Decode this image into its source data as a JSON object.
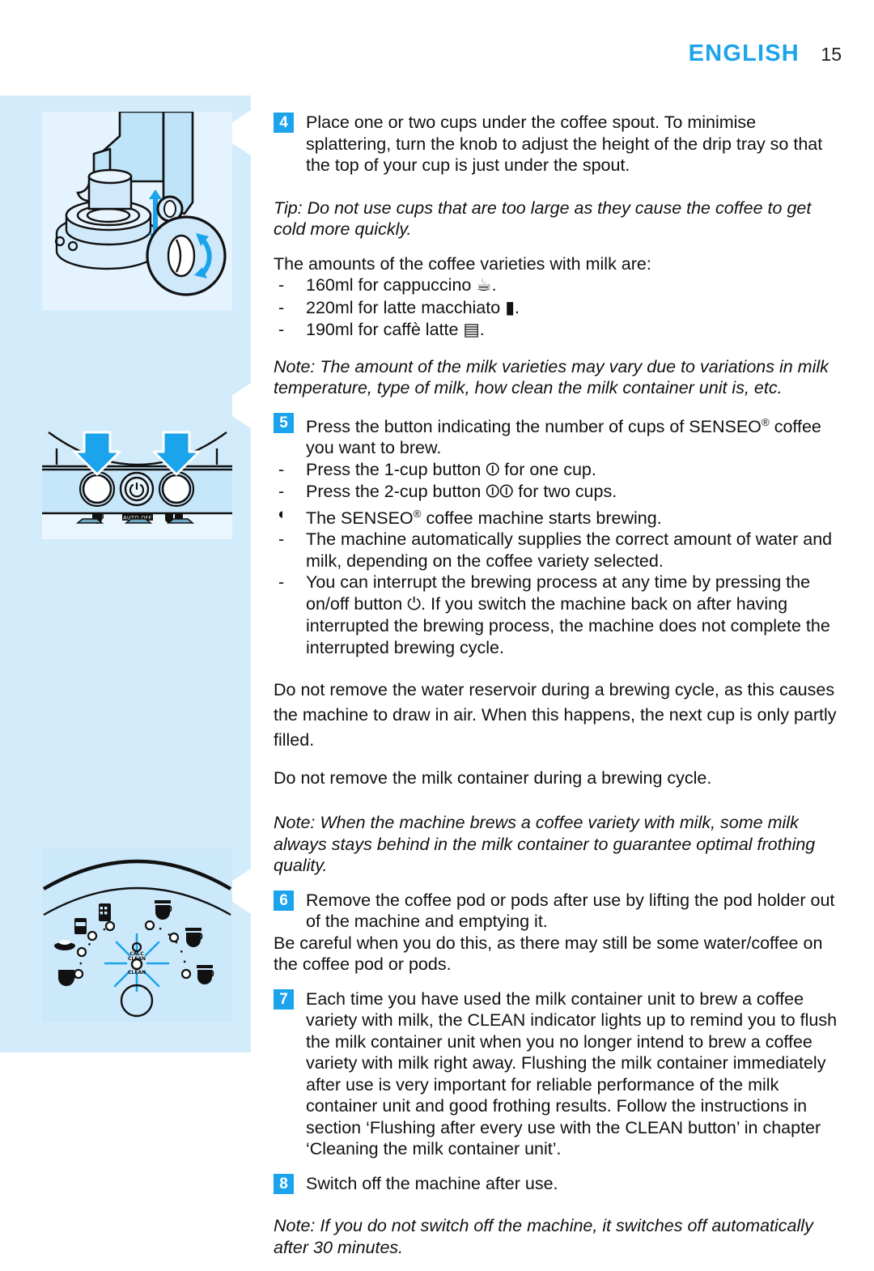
{
  "header": {
    "language": "ENGLISH",
    "page_number": "15"
  },
  "figures": [
    {
      "name": "drip-tray-height-adjustment",
      "caption_icons": [
        "cup-on-drip-tray",
        "up-down-arrow",
        "knob-rotation-detail"
      ]
    },
    {
      "name": "control-panel-cup-buttons",
      "caption_icons": [
        "one-cup-button",
        "power-auto-off-button",
        "two-cup-button",
        "down-arrow",
        "down-arrow"
      ],
      "labels": {
        "auto_off": "AUTO OFF"
      }
    },
    {
      "name": "coffee-variety-dial-clean-indicator",
      "labels": {
        "calc_clean": "CALC CLEAN",
        "clean": "CLEAN"
      }
    }
  ],
  "content": {
    "step4": {
      "number": "4",
      "text": "Place one or two cups under the coffee spout. To minimise splattering, turn the knob to adjust the height of the drip tray so that the top of your cup is just under the spout."
    },
    "tip1": "Tip: Do not use cups that are too large as they cause the coffee to get cold more quickly.",
    "amounts_intro": "The amounts of the coffee varieties with milk are:",
    "amounts": [
      {
        "marker": "-",
        "text": "160ml for cappuccino",
        "icon": "cappuccino-cup-icon",
        "glyph": "☕",
        "suffix": "."
      },
      {
        "marker": "-",
        "text": "220ml for latte macchiato",
        "icon": "latte-macchiato-glass-icon",
        "glyph": "▮",
        "suffix": "."
      },
      {
        "marker": "-",
        "text": "190ml for caffè latte",
        "icon": "caffe-latte-glass-icon",
        "glyph": "▤",
        "suffix": "."
      }
    ],
    "note1": "Note: The amount of the milk varieties may vary due to variations in milk temperature, type of milk, how clean the milk container unit is, etc.",
    "step5": {
      "number": "5",
      "text_before": "Press the button indicating the number of cups of SENSEO",
      "reg": "®",
      "text_after": " coffee you want to brew."
    },
    "step5_items": [
      {
        "marker": "-",
        "before": "Press the 1-cup button ",
        "icon": "one-cup-icon",
        "glyph": "⏼",
        "after": " for one cup."
      },
      {
        "marker": "-",
        "before": "Press the 2-cup button ",
        "icon": "two-cup-icon",
        "glyph": "⏼⏼",
        "after": " for two cups."
      }
    ],
    "result1": {
      "marker": "◖",
      "before": "The SENSEO",
      "reg": "®",
      "after": " coffee machine starts brewing."
    },
    "step5_notes": [
      {
        "marker": "-",
        "text": "The machine automatically supplies the correct amount of water and milk, depending on the coffee variety selected."
      },
      {
        "marker": "-",
        "before": "You can interrupt the brewing process at any time by pressing the on/off button ",
        "icon": "power-icon",
        "glyph": "⏻",
        "after": ". If you switch the machine back on after having interrupted the brewing process, the machine does not complete the interrupted brewing cycle."
      }
    ],
    "warning1": "Do not remove the water reservoir during a brewing cycle, as this causes the machine to draw in air. When this happens, the next cup is only partly filled.",
    "warning2": "Do not remove the milk container during a brewing cycle.",
    "note2": "Note: When the machine brews a coffee variety with milk, some milk always stays behind in the milk container to guarantee optimal frothing quality.",
    "step6": {
      "number": "6",
      "text": "Remove the coffee pod or pods after use by lifting the pod holder out of the machine and emptying it."
    },
    "careful": "Be careful when you do this, as there may still be some water/coffee on the coffee pod or pods.",
    "step7": {
      "number": "7",
      "text": "Each time you have used the milk container unit to brew a coffee variety with milk, the CLEAN indicator lights up to remind you to flush the milk container unit when you no longer intend to brew a coffee variety with milk right away. Flushing the milk container immediately after use is very important for reliable performance of the milk container unit and good frothing results. Follow the instructions in section ‘Flushing after every use with the CLEAN button’ in chapter ‘Cleaning the milk container unit’."
    },
    "step8": {
      "number": "8",
      "text": "Switch off the machine after use."
    },
    "note3": "Note: If you do not switch off the machine, it switches off automatically after 30 minutes."
  },
  "colors": {
    "accent_blue": "#1BA3EC",
    "band_blue": "#d3ecfb",
    "panel_blue": "#e4f3fd"
  }
}
